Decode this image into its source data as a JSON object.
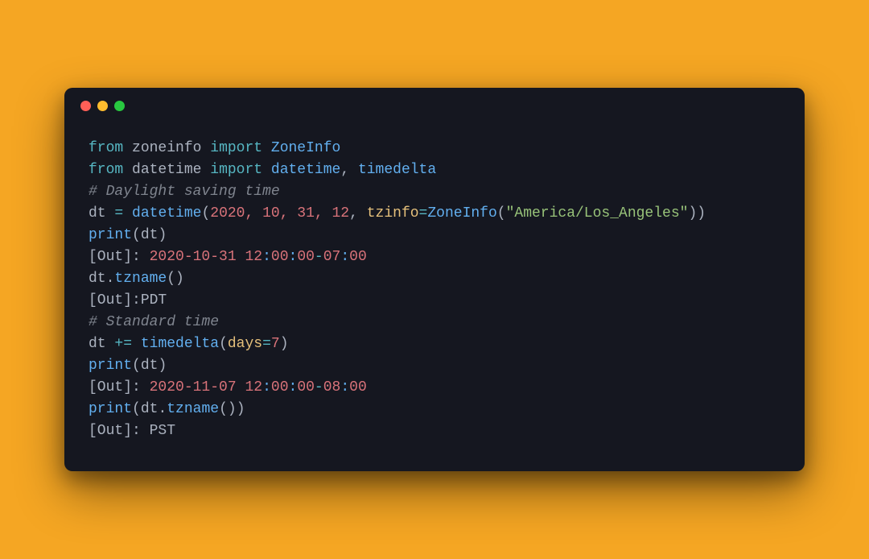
{
  "window": {
    "traffic_lights": [
      "close",
      "minimize",
      "zoom"
    ]
  },
  "code": {
    "l1": {
      "from": "from",
      "mod1": "zoneinfo",
      "import": "import",
      "name1": "ZoneInfo"
    },
    "l2": {
      "from": "from",
      "mod": "datetime",
      "import": "import",
      "name1": "datetime",
      "comma": ",",
      "name2": "timedelta"
    },
    "blank1": "",
    "c1": "# Daylight saving time",
    "l3": {
      "var": "dt",
      "eq": "=",
      "fn": "datetime",
      "op": "(",
      "args_nums": "2020, 10, 31, 12",
      "comma": ",",
      "kw": "tzinfo",
      "eq2": "=",
      "zi": "ZoneInfo",
      "op2": "(",
      "str": "\"America/Los_Angeles\"",
      "cl2": ")",
      "cl": ")"
    },
    "l4": {
      "fn": "print",
      "op": "(",
      "arg": "dt",
      "cl": ")"
    },
    "o1": {
      "tag": "[Out]:",
      "sp": " ",
      "date": "2020-10-31",
      "time": "12:00:00",
      "off": "-07:00"
    },
    "l5": {
      "obj": "dt",
      "dot": ".",
      "fn": "tzname",
      "op": "(",
      "cl": ")"
    },
    "o2": {
      "tag": "[Out]:",
      "val": "PDT"
    },
    "blank2": "",
    "c2": "# Standard time",
    "l6": {
      "var": "dt",
      "op": "+=",
      "fn": "timedelta",
      "p1": "(",
      "kw": "days",
      "eq": "=",
      "num": "7",
      "p2": ")"
    },
    "l7": {
      "fn": "print",
      "op": "(",
      "arg": "dt",
      "cl": ")"
    },
    "o3": {
      "tag": "[Out]:",
      "sp": " ",
      "date": "2020-11-07",
      "time": "12:00:00",
      "off": "-08:00"
    },
    "l8": {
      "fn": "print",
      "op": "(",
      "obj": "dt",
      "dot": ".",
      "mfn": "tzname",
      "p1": "(",
      "p2": ")",
      "cl": ")"
    },
    "o4": {
      "tag": "[Out]:",
      "sp": " ",
      "val": "PST"
    }
  }
}
